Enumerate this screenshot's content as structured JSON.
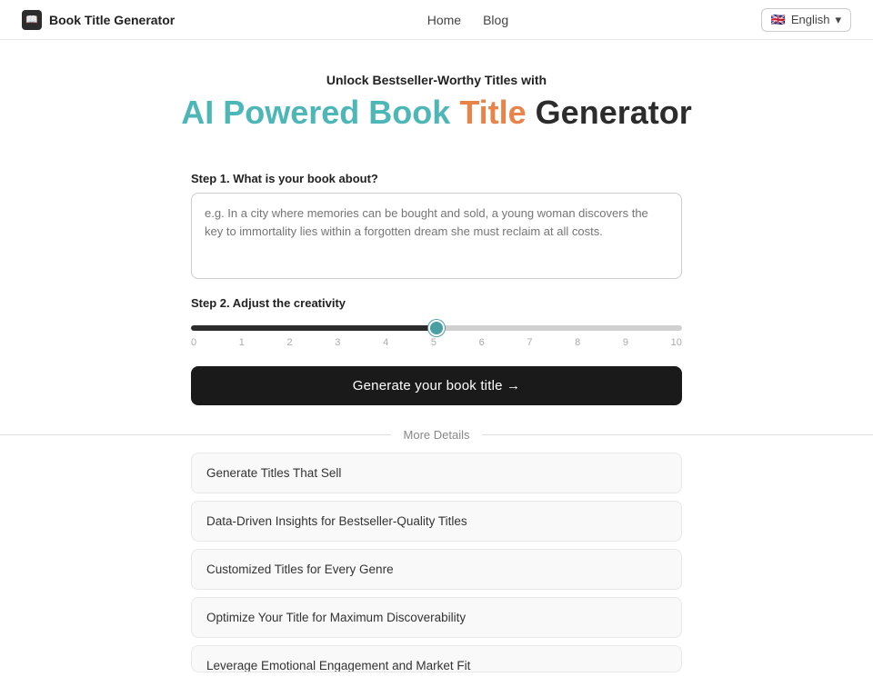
{
  "brand": {
    "icon_text": "📖",
    "name": "Book Title Generator"
  },
  "nav": {
    "home_label": "Home",
    "blog_label": "Blog",
    "language_label": "English",
    "language_flag": "🇬🇧"
  },
  "hero": {
    "subtitle": "Unlock Bestseller-Worthy Titles with",
    "title_part1": "AI Powered Book ",
    "title_part2": "Title",
    "title_part3": " Generator"
  },
  "form": {
    "step1_label": "Step 1. What is your book about?",
    "textarea_placeholder": "e.g. In a city where memories can be bought and sold, a young woman discovers the key to immortality lies within a forgotten dream she must reclaim at all costs.",
    "step2_label": "Step 2. Adjust the creativity",
    "slider_min": 0,
    "slider_max": 10,
    "slider_value": 5,
    "slider_ticks": [
      "0",
      "1",
      "2",
      "3",
      "4",
      "5",
      "6",
      "7",
      "8",
      "9",
      "10"
    ],
    "generate_btn_label": "Generate your book title →"
  },
  "more_details": {
    "section_label": "More Details",
    "items": [
      "Generate Titles That Sell",
      "Data-Driven Insights for Bestseller-Quality Titles",
      "Customized Titles for Every Genre",
      "Optimize Your Title for Maximum Discoverability",
      "Leverage Emotional Engagement and Market Fit"
    ]
  }
}
